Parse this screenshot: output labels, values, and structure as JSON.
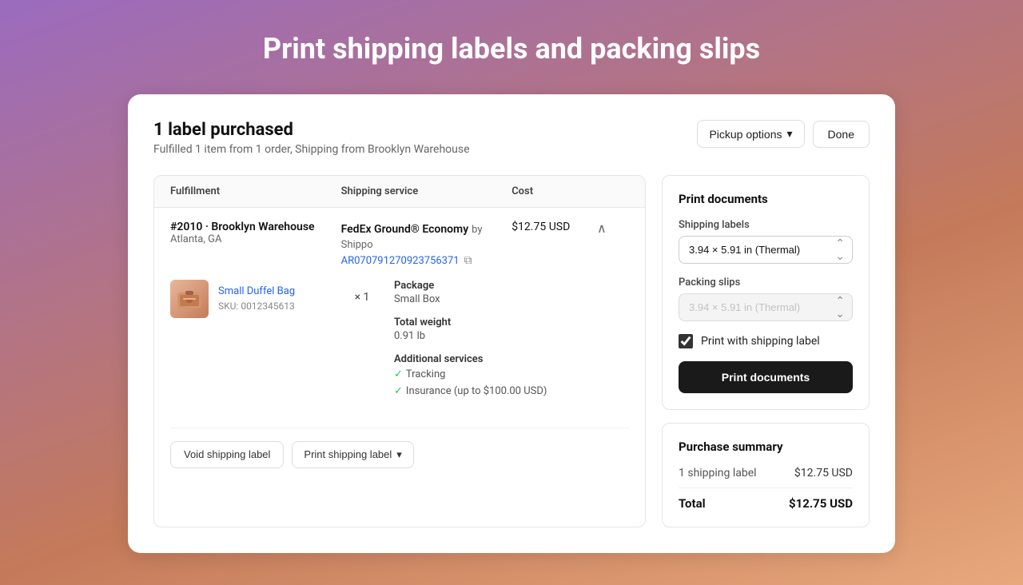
{
  "page": {
    "title": "Print shipping labels and packing slips",
    "background": "linear-gradient(160deg, #9b6bbf 0%, #c47a5a 60%, #e8a87c 100%)"
  },
  "header": {
    "title": "1 label purchased",
    "subtitle": "Fulfilled 1 item from 1 order, Shipping from Brooklyn Warehouse",
    "pickup_options_label": "Pickup options",
    "done_label": "Done"
  },
  "table": {
    "columns": [
      "Fulfillment",
      "Shipping service",
      "Cost",
      ""
    ],
    "row": {
      "warehouse": "#2010 · Brooklyn Warehouse",
      "location": "Atlanta, GA",
      "service_name": "FedEx Ground® Economy",
      "service_provider": "by Shippo",
      "tracking_number": "AR070791270923756371",
      "cost": "$12.75 USD"
    },
    "item": {
      "name": "Small Duffel Bag",
      "sku": "SKU: 0012345613",
      "quantity": "× 1",
      "package_label": "Package",
      "package_value": "Small Box",
      "weight_label": "Total weight",
      "weight_value": "0.91 lb",
      "services_label": "Additional services",
      "services": [
        "✓ Tracking",
        "✓ Insurance (up to $100.00 USD)"
      ]
    },
    "action_buttons": {
      "void_label": "Void shipping label",
      "print_label": "Print shipping label"
    }
  },
  "print_documents": {
    "section_title": "Print documents",
    "shipping_labels_label": "Shipping labels",
    "shipping_labels_value": "3.94 × 5.91 in (Thermal)",
    "packing_slips_label": "Packing slips",
    "packing_slips_value": "3.94 × 5.91 in (Thermal)",
    "checkbox_label": "Print with shipping label",
    "print_button_label": "Print documents"
  },
  "purchase_summary": {
    "section_title": "Purchase summary",
    "line_item_label": "1 shipping label",
    "line_item_value": "$12.75 USD",
    "total_label": "Total",
    "total_value": "$12.75 USD"
  }
}
